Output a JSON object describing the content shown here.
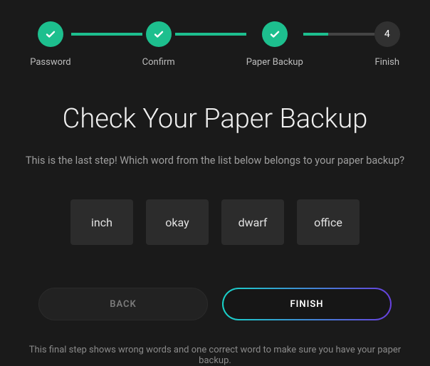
{
  "stepper": {
    "steps": [
      {
        "label": "Password",
        "status": "done"
      },
      {
        "label": "Confirm",
        "status": "done"
      },
      {
        "label": "Paper Backup",
        "status": "done"
      },
      {
        "label": "Finish",
        "status": "pending",
        "number": "4"
      }
    ]
  },
  "title": "Check Your Paper Backup",
  "subtitle": "This is the last step! Which word from the list below belongs to your paper backup?",
  "words": [
    "inch",
    "okay",
    "dwarf",
    "office"
  ],
  "buttons": {
    "back": "BACK",
    "finish": "FINISH"
  },
  "footer": "This final step shows wrong words and one correct word to make sure you have your paper backup.",
  "colors": {
    "accent": "#1dbf8e"
  }
}
